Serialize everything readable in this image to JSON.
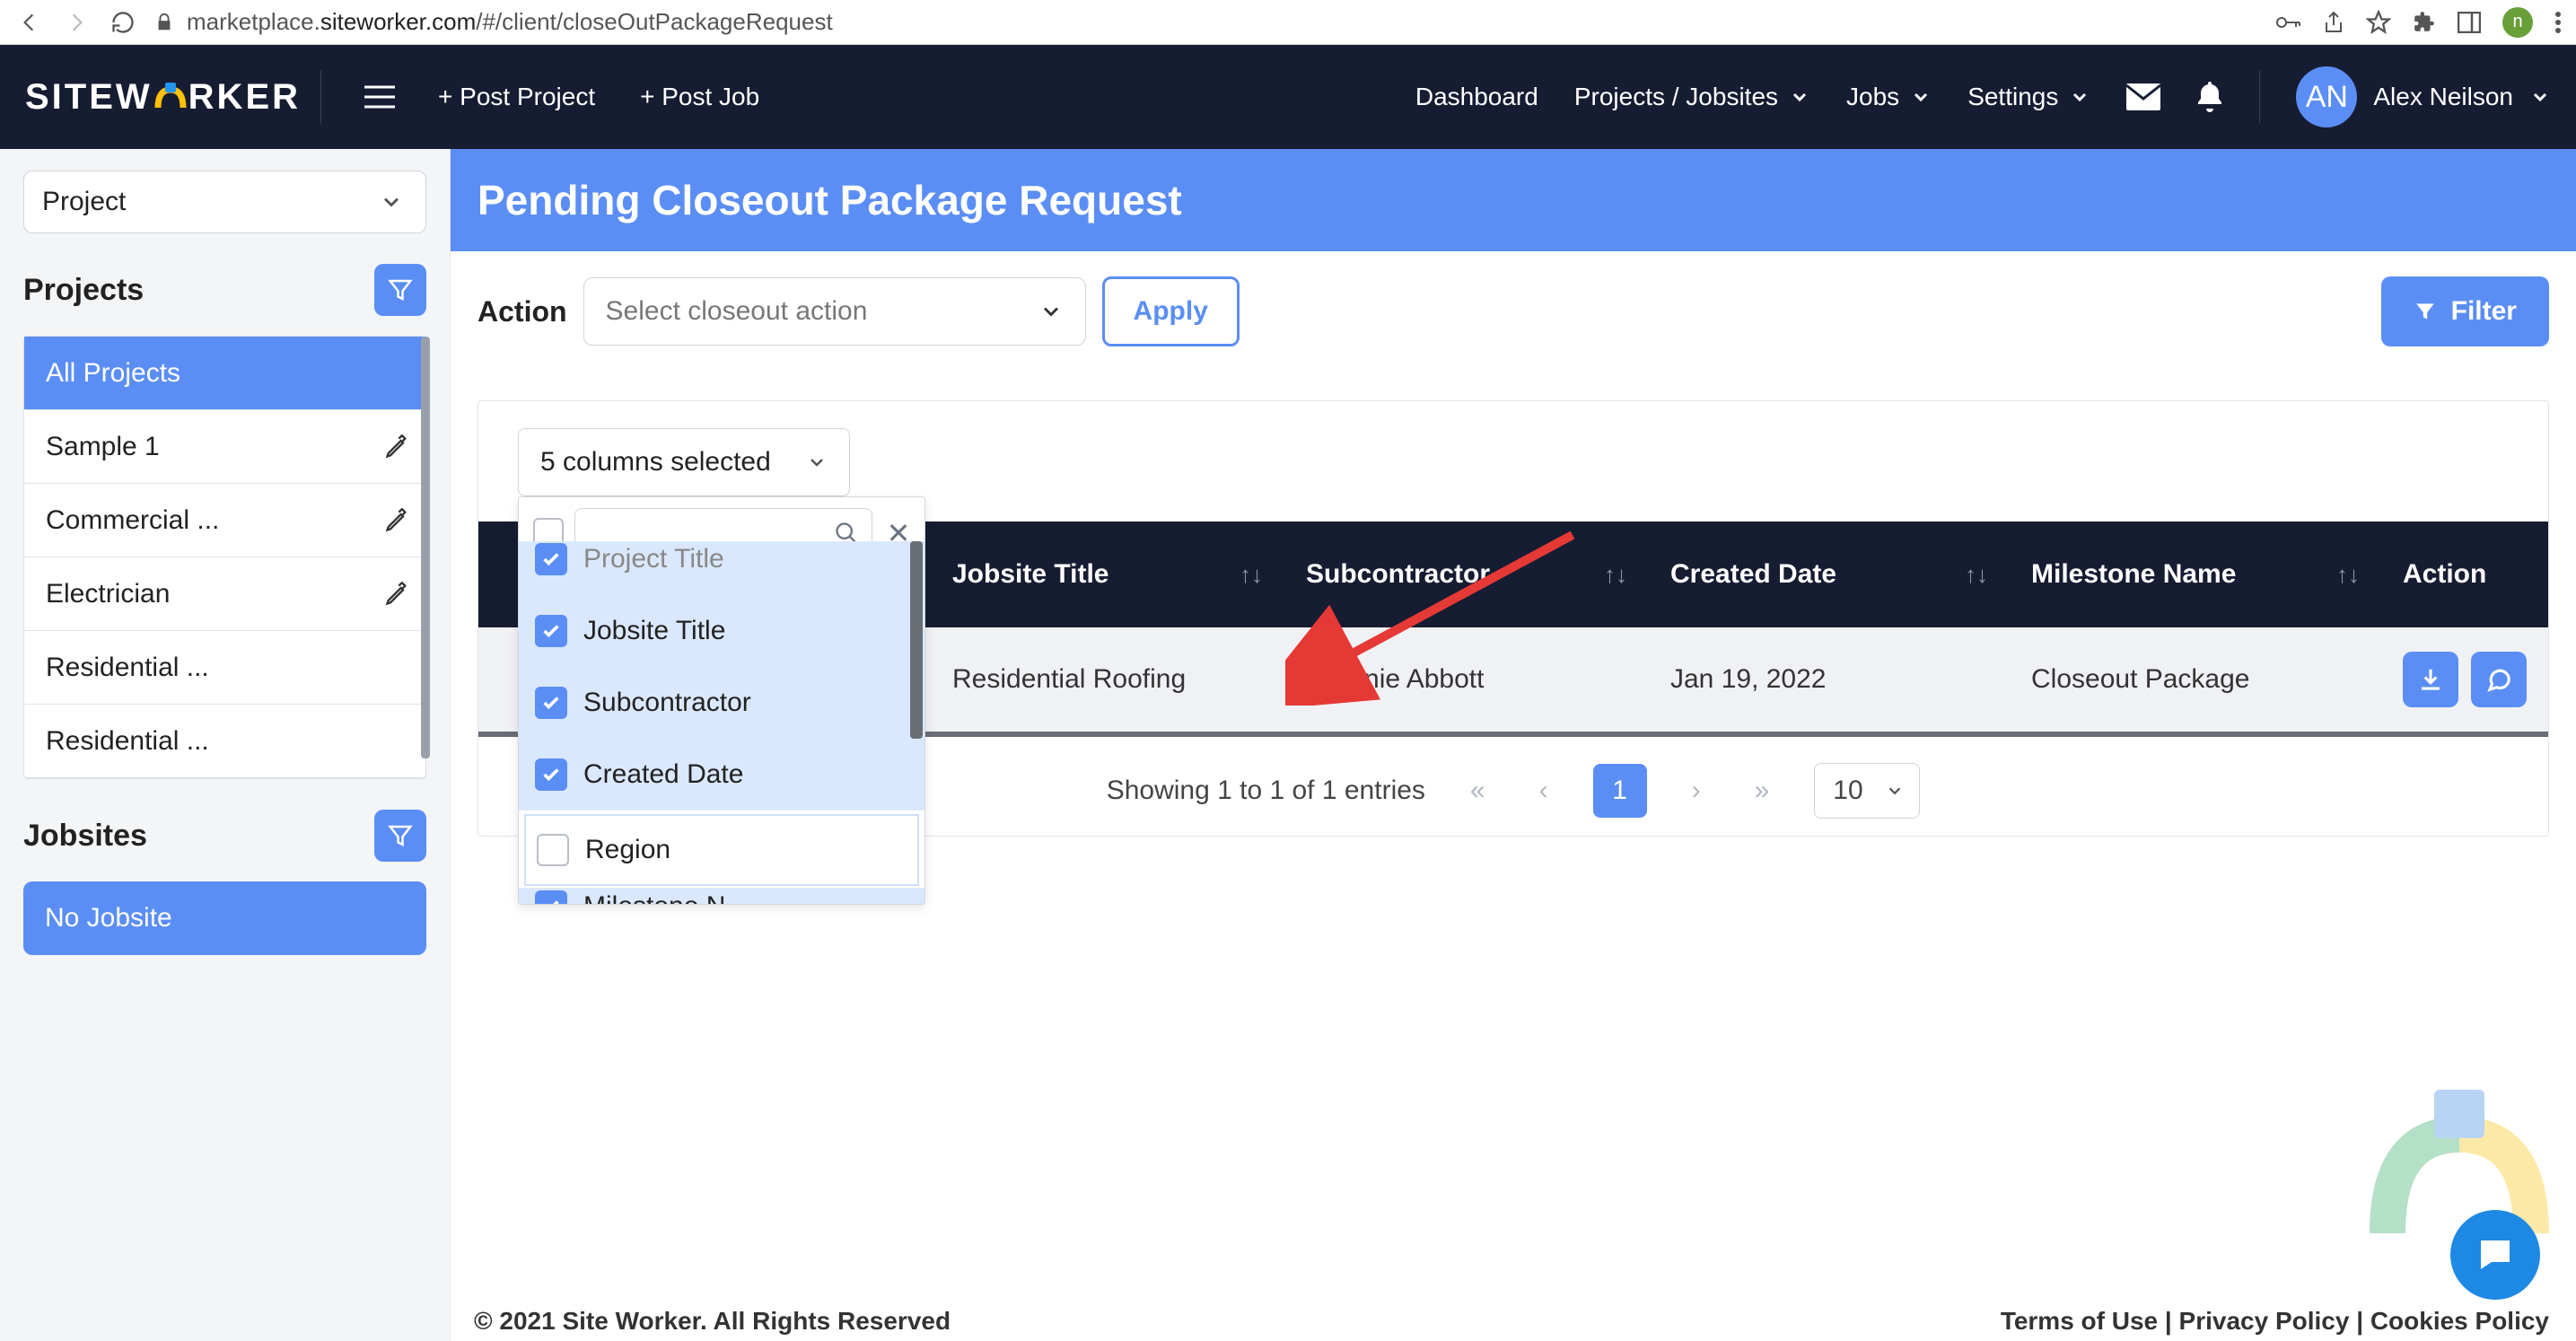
{
  "browser": {
    "url_prefix": "marketplace.",
    "url_domain": "siteworker.com",
    "url_path": "/#/client/closeOutPackageRequest",
    "profile_initial": "n"
  },
  "nav": {
    "brand_pre": "SITEW",
    "brand_post": "RKER",
    "post_project": "+ Post Project",
    "post_job": "+ Post Job",
    "dashboard": "Dashboard",
    "projects": "Projects / Jobsites",
    "jobs": "Jobs",
    "settings": "Settings",
    "user_initials": "AN",
    "user_name": "Alex Neilson"
  },
  "sidebar": {
    "select_label": "Project",
    "projects_label": "Projects",
    "jobsites_label": "Jobsites",
    "projects": [
      {
        "label": "All Projects",
        "active": true,
        "editable": false
      },
      {
        "label": "Sample 1",
        "active": false,
        "editable": true
      },
      {
        "label": "Commercial ...",
        "active": false,
        "editable": true
      },
      {
        "label": "Electrician",
        "active": false,
        "editable": true
      },
      {
        "label": "Residential ...",
        "active": false,
        "editable": false
      },
      {
        "label": "Residential ...",
        "active": false,
        "editable": false
      }
    ],
    "no_jobsite": "No Jobsite"
  },
  "page": {
    "title": "Pending Closeout Package Request",
    "action_label": "Action",
    "action_placeholder": "Select closeout action",
    "apply": "Apply",
    "filter": "Filter",
    "column_select_label": "5 columns selected",
    "column_options": [
      {
        "label": "Project Title",
        "checked": true
      },
      {
        "label": "Jobsite Title",
        "checked": true
      },
      {
        "label": "Subcontractor",
        "checked": true
      },
      {
        "label": "Created Date",
        "checked": true
      },
      {
        "label": "Region",
        "checked": false
      },
      {
        "label": "Milestone N",
        "checked": true
      }
    ],
    "columns": [
      "Jobsite Title",
      "Subcontractor",
      "Created Date",
      "Milestone Name",
      "Action"
    ],
    "row": {
      "jobsite": "Residential Roofing",
      "subcontractor": "Melanie Abbott",
      "created": "Jan 19, 2022",
      "milestone": "Closeout Package"
    },
    "pagination_text": "Showing 1 to 1 of 1 entries",
    "page_num": "1",
    "page_size": "10"
  },
  "footer": {
    "copyright": "© 2021 Site Worker. All Rights Reserved",
    "links_text": "Terms of Use | Privacy Policy | Cookies Policy"
  }
}
